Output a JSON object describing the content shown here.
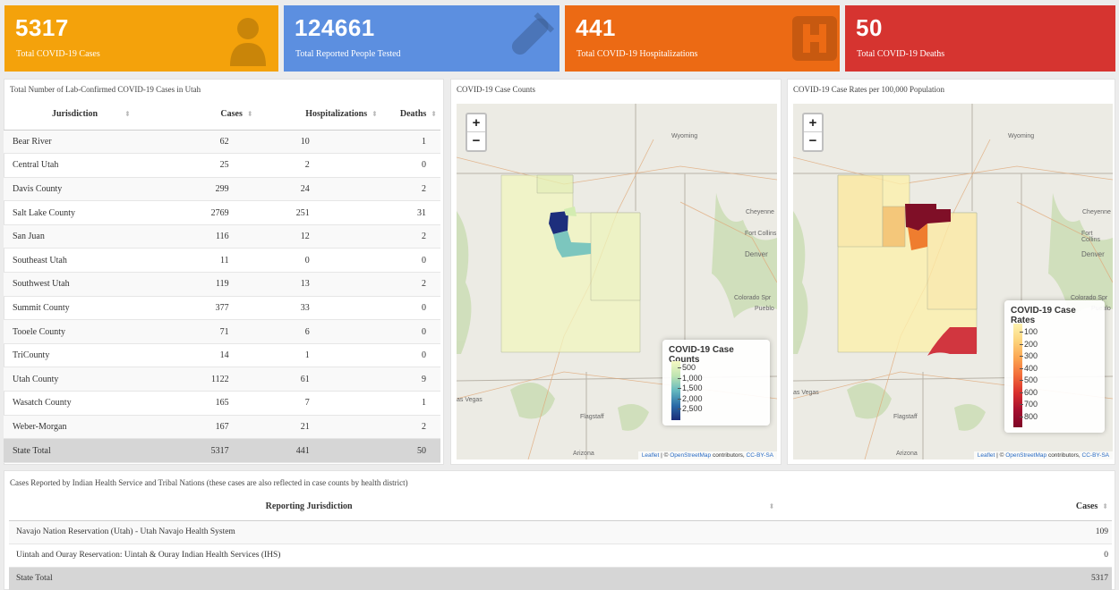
{
  "value_boxes": [
    {
      "value": "5317",
      "label": "Total COVID-19 Cases",
      "color": "#f4a20b",
      "icon": "person-icon"
    },
    {
      "value": "124661",
      "label": "Total Reported People Tested",
      "color": "#5c8fe0",
      "icon": "test-tube-icon"
    },
    {
      "value": "441",
      "label": "Total COVID-19 Hospitalizations",
      "color": "#ec6a14",
      "icon": "hospital-icon"
    },
    {
      "value": "50",
      "label": "Total COVID-19 Deaths",
      "color": "#d63430",
      "icon": "none"
    }
  ],
  "table_panel": {
    "title": "Total Number of Lab-Confirmed COVID-19 Cases in Utah",
    "columns": [
      "Jurisdiction",
      "Cases",
      "Hospitalizations",
      "Deaths"
    ],
    "rows": [
      [
        "Bear River",
        "62",
        "10",
        "1"
      ],
      [
        "Central Utah",
        "25",
        "2",
        "0"
      ],
      [
        "Davis County",
        "299",
        "24",
        "2"
      ],
      [
        "Salt Lake County",
        "2769",
        "251",
        "31"
      ],
      [
        "San Juan",
        "116",
        "12",
        "2"
      ],
      [
        "Southeast Utah",
        "11",
        "0",
        "0"
      ],
      [
        "Southwest Utah",
        "119",
        "13",
        "2"
      ],
      [
        "Summit County",
        "377",
        "33",
        "0"
      ],
      [
        "Tooele County",
        "71",
        "6",
        "0"
      ],
      [
        "TriCounty",
        "14",
        "1",
        "0"
      ],
      [
        "Utah County",
        "1122",
        "61",
        "9"
      ],
      [
        "Wasatch County",
        "165",
        "7",
        "1"
      ],
      [
        "Weber-Morgan",
        "167",
        "21",
        "2"
      ]
    ],
    "total": [
      "State Total",
      "5317",
      "441",
      "50"
    ]
  },
  "map_counts": {
    "title": "COVID-19 Case Counts",
    "zoom_in": "+",
    "zoom_out": "−",
    "legend_title": "COVID-19 Case Counts",
    "legend_ticks": [
      "500",
      "1,000",
      "1,500",
      "2,000",
      "2,500"
    ],
    "place_labels": [
      "Wyoming",
      "Cheyenne",
      "Fort Collins",
      "Denver",
      "Colorado Spr",
      "Pueblo",
      "as Vegas",
      "Flagstaff",
      "Arizona"
    ],
    "attribution_leaflet": "Leaflet",
    "attribution_sep": " | © ",
    "attribution_osm": "OpenStreetMap",
    "attribution_contrib": " contributors, ",
    "attribution_license": "CC-BY-SA"
  },
  "map_rates": {
    "title": "COVID-19 Case Rates per 100,000 Population",
    "zoom_in": "+",
    "zoom_out": "−",
    "legend_title": "COVID-19 Case Rates",
    "legend_ticks": [
      "100",
      "200",
      "300",
      "400",
      "500",
      "600",
      "700",
      "800"
    ],
    "place_labels": [
      "Wyoming",
      "Cheyenne",
      "Fort Collins",
      "Denver",
      "Colorado Spr",
      "Pueblo",
      "as Vegas",
      "Flagstaff",
      "Arizona"
    ],
    "attribution_leaflet": "Leaflet",
    "attribution_sep": " | © ",
    "attribution_osm": "OpenStreetMap",
    "attribution_contrib": " contributors, ",
    "attribution_license": "CC-BY-SA"
  },
  "tribal_panel": {
    "title": "Cases Reported by Indian Health Service and Tribal Nations (these cases are also reflected in case counts by health district)",
    "columns": [
      "Reporting Jurisdiction",
      "Cases"
    ],
    "rows": [
      [
        "Navajo Nation Reservation (Utah) - Utah Navajo Health System",
        "109"
      ],
      [
        "Uintah and Ouray Reservation: Uintah & Ouray Indian Health Services (IHS)",
        "0"
      ]
    ],
    "total": [
      "State Total",
      "5317"
    ]
  }
}
